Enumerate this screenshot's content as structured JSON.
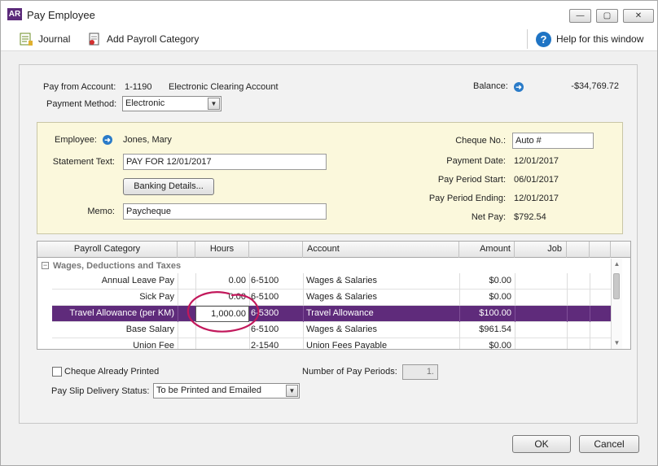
{
  "window": {
    "icon_text": "AR",
    "title": "Pay Employee",
    "min_label": "—",
    "max_label": "▢",
    "close_label": "✕"
  },
  "toolbar": {
    "journal": "Journal",
    "add_payroll_category": "Add Payroll Category",
    "help": "Help for this window"
  },
  "header": {
    "pay_from_label": "Pay from Account:",
    "account_number": "1-1190",
    "account_name": "Electronic Clearing Account",
    "balance_label": "Balance:",
    "balance_value": "-$34,769.72",
    "payment_method_label": "Payment Method:",
    "payment_method_value": "Electronic"
  },
  "employee": {
    "employee_label": "Employee:",
    "employee_value": "Jones, Mary",
    "statement_label": "Statement Text:",
    "statement_value": "PAY FOR 12/01/2017",
    "banking_button": "Banking Details...",
    "memo_label": "Memo:",
    "memo_value": "Paycheque",
    "cheque_no_label": "Cheque No.:",
    "cheque_no_value": "Auto #",
    "payment_date_label": "Payment Date:",
    "payment_date_value": "12/01/2017",
    "period_start_label": "Pay Period Start:",
    "period_start_value": "06/01/2017",
    "period_end_label": "Pay Period Ending:",
    "period_end_value": "12/01/2017",
    "net_pay_label": "Net Pay:",
    "net_pay_value": "$792.54"
  },
  "grid": {
    "headers": [
      "Payroll Category",
      "Hours",
      "Account",
      "Amount",
      "Job"
    ],
    "group_label": "Wages, Deductions and Taxes",
    "rows": [
      {
        "category": "Annual Leave Pay",
        "hours": "0.00",
        "account_no": "6-5100",
        "account": "Wages & Salaries",
        "amount": "$0.00"
      },
      {
        "category": "Sick Pay",
        "hours": "0.00",
        "account_no": "6-5100",
        "account": "Wages & Salaries",
        "amount": "$0.00"
      },
      {
        "category": "Travel Allowance (per KM)",
        "hours": "1,000.00",
        "account_no": "6-5300",
        "account": "Travel Allowance",
        "amount": "$100.00"
      },
      {
        "category": "Base Salary",
        "hours": "",
        "account_no": "6-5100",
        "account": "Wages & Salaries",
        "amount": "$961.54"
      },
      {
        "category": "Union Fee",
        "hours": "",
        "account_no": "2-1540",
        "account": "Union Fees Payable",
        "amount": "$0.00"
      }
    ]
  },
  "footer": {
    "cheque_printed_label": "Cheque Already Printed",
    "num_periods_label": "Number of Pay Periods:",
    "num_periods_value": "1.",
    "delivery_label": "Pay Slip Delivery Status:",
    "delivery_value": "To be Printed and Emailed",
    "ok": "OK",
    "cancel": "Cancel"
  },
  "colors": {
    "selected_row": "#5f2b7b",
    "employee_panel": "#fbf8dc",
    "annotation": "#c2185b"
  }
}
